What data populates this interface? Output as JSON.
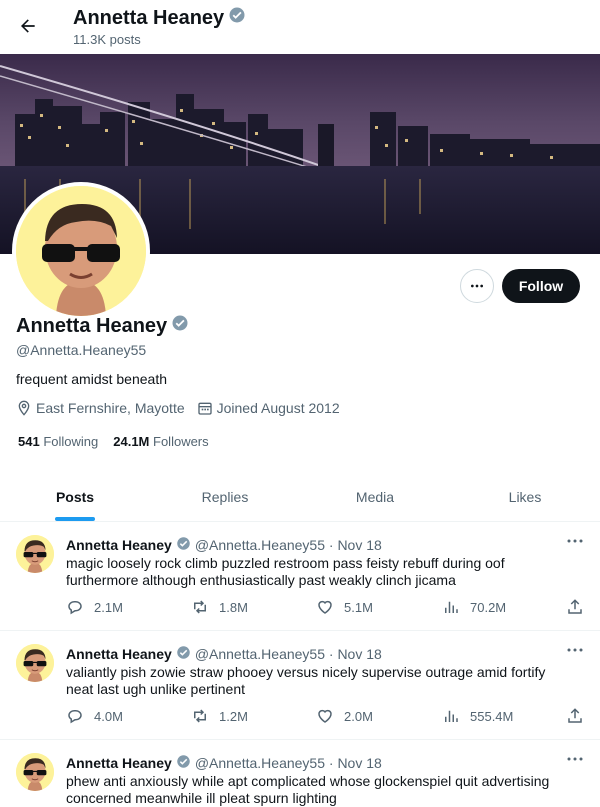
{
  "header": {
    "name": "Annetta Heaney",
    "posts_count": "11.3K posts"
  },
  "profile": {
    "name": "Annetta Heaney",
    "handle": "@Annetta.Heaney55",
    "bio": "frequent amidst beneath",
    "location": "East Fernshire, Mayotte",
    "joined": "Joined August 2012",
    "following_count": "541",
    "following_label": "Following",
    "followers_count": "24.1M",
    "followers_label": "Followers",
    "follow_label": "Follow"
  },
  "tabs": [
    {
      "label": "Posts",
      "active": true
    },
    {
      "label": "Replies"
    },
    {
      "label": "Media"
    },
    {
      "label": "Likes"
    }
  ],
  "tweets": [
    {
      "name": "Annetta Heaney",
      "meta": "@Annetta.Heaney55 · Nov 18",
      "text": "magic loosely rock climb puzzled restroom pass feisty rebuff during oof furthermore although enthusiastically past weakly clinch jicama",
      "replies": "2.1M",
      "reposts": "1.8M",
      "likes": "5.1M",
      "views": "70.2M"
    },
    {
      "name": "Annetta Heaney",
      "meta": "@Annetta.Heaney55 · Nov 18",
      "text": "valiantly pish zowie straw phooey versus nicely supervise outrage amid fortify neat last ugh unlike pertinent",
      "replies": "4.0M",
      "reposts": "1.2M",
      "likes": "2.0M",
      "views": "555.4M"
    },
    {
      "name": "Annetta Heaney",
      "meta": "@Annetta.Heaney55 · Nov 18",
      "text": "phew anti anxiously while apt complicated whose glockenspiel quit advertising concerned meanwhile ill pleat spurn lighting",
      "replies": "",
      "reposts": "",
      "likes": "",
      "views": ""
    }
  ],
  "colors": {
    "accent": "#1d9bf0",
    "verified": "#829aab",
    "text": "#0f1419",
    "muted": "#536471"
  }
}
